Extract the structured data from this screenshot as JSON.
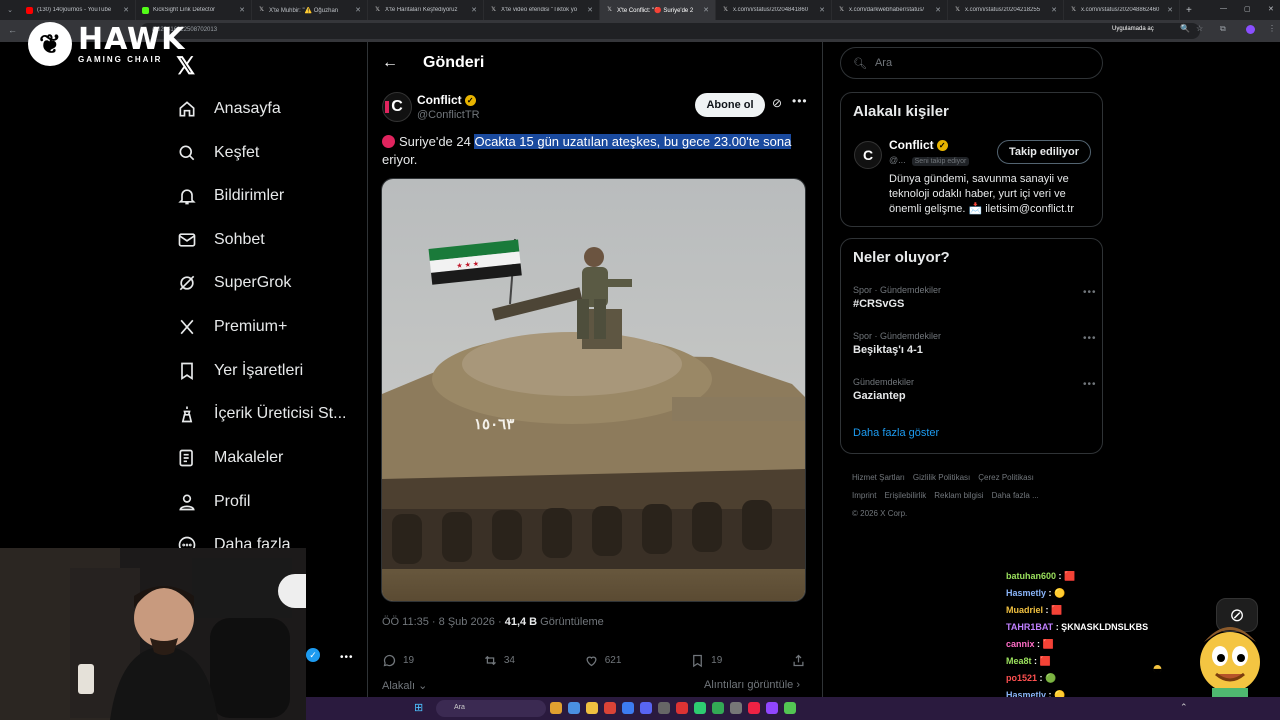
{
  "browser": {
    "tabs": [
      {
        "title": "(130) 140journos - YouTube",
        "icon": "youtube-icon",
        "active": false
      },
      {
        "title": "KickSight Link Detector",
        "icon": "kick-icon",
        "active": false
      },
      {
        "title": "X'te Muhbir: \"⚠️ Oğuzhan",
        "icon": "x-icon",
        "active": false
      },
      {
        "title": "X'te Haritaları Keşfediyoruz",
        "icon": "x-icon",
        "active": false
      },
      {
        "title": "X'te video efendisi \"Tiktok yo",
        "icon": "x-icon",
        "active": false
      },
      {
        "title": "X'te Conflict: \"🔴 Suriye'de 2",
        "icon": "x-icon",
        "active": true
      },
      {
        "title": "x.com/i/status/20204841860",
        "icon": "x-icon",
        "active": false
      },
      {
        "title": "x.com/darkwebhaber/status/",
        "icon": "x-icon",
        "active": false
      },
      {
        "title": "x.com/i/status/20204218255",
        "icon": "x-icon",
        "active": false
      },
      {
        "title": "x.com/i/status/202048862460",
        "icon": "x-icon",
        "active": false
      }
    ],
    "url": "/2020416122508702013",
    "app_notice": "Uygulamada aç"
  },
  "overlay": {
    "brand": "HAWK",
    "brand_sub": "GAMING CHAIR"
  },
  "nav": {
    "items": [
      {
        "label": "Anasayfa",
        "icon": "home-icon"
      },
      {
        "label": "Keşfet",
        "icon": "search-icon"
      },
      {
        "label": "Bildirimler",
        "icon": "bell-icon"
      },
      {
        "label": "Sohbet",
        "icon": "mail-icon"
      },
      {
        "label": "SuperGrok",
        "icon": "grok-icon"
      },
      {
        "label": "Premium+",
        "icon": "x-premium-icon"
      },
      {
        "label": "Yer İşaretleri",
        "icon": "bookmark-icon"
      },
      {
        "label": "İçerik Üreticisi St...",
        "icon": "creator-studio-icon"
      },
      {
        "label": "Makaleler",
        "icon": "article-icon"
      },
      {
        "label": "Profil",
        "icon": "person-icon"
      },
      {
        "label": "Daha fazla",
        "icon": "more-circle-icon"
      }
    ]
  },
  "post": {
    "page_title": "Gönderi",
    "author_name": "Conflict",
    "author_handle": "@ConflictTR",
    "subscribe_label": "Abone ol",
    "text_before": "Suriye'de 24 ",
    "text_highlight": "Ocakta 15 gün uzatılan ateşkes, bu gece 23.00'te sona",
    "text_after": " eriyor.",
    "image_caption_text": "١٥٠٦٣",
    "time": "ÖÖ 11:35 · 8 Şub 2026 · ",
    "views": "41,4 B",
    "views_label": " Görüntüleme",
    "replies": "19",
    "reposts": "34",
    "likes": "621",
    "bookmarks": "19",
    "relevant_label": "Alakalı",
    "quotes_label": "Alıntıları görüntüle"
  },
  "right": {
    "search_placeholder": "Ara",
    "related_title": "Alakalı kişiler",
    "related_name": "Conflict",
    "related_handle": "@...",
    "related_follows_you": "Seni takip ediyor",
    "related_button": "Takip ediliyor",
    "related_bio": "Dünya gündemi, savunma sanayii ve teknoloji odaklı haber, yurt içi veri ve önemli gelişme. 📩 iletisim@conflict.tr",
    "trends_title": "Neler oluyor?",
    "trends": [
      {
        "category": "Spor · Gündemdekiler",
        "name": "#CRSvGS"
      },
      {
        "category": "Spor · Gündemdekiler",
        "name": "Beşiktaş'ı 4-1"
      },
      {
        "category": "Gündemdekiler",
        "name": "Gaziantep"
      }
    ],
    "show_more": "Daha fazla göster",
    "footer": [
      "Hizmet Şartları",
      "Gizlilik Politikası",
      "Çerez Politikası",
      "Imprint",
      "Erişilebilirlik",
      "Reklam bilgisi",
      "Daha fazla ...",
      "© 2026 X Corp."
    ]
  },
  "chat": [
    {
      "user": "batuhan600",
      "color": "#9be15d",
      "msg": ": 🟥"
    },
    {
      "user": "Hasmetly",
      "color": "#8ab4f8",
      "msg": ": 🟡"
    },
    {
      "user": "Muadriel",
      "color": "#f0c040",
      "msg": ": 🟥"
    },
    {
      "user": "TAHR1BAT",
      "color": "#c080ff",
      "msg": ": ŞKNASKLDNSLKBS"
    },
    {
      "user": "cannix",
      "color": "#ff6ec7",
      "msg": ": 🟥"
    },
    {
      "user": "Mea8t",
      "color": "#9be15d",
      "msg": ": 🟥"
    },
    {
      "user": "po1521",
      "color": "#ff5050",
      "msg": ": 🟢"
    },
    {
      "user": "Hasmetly",
      "color": "#8ab4f8",
      "msg": ": 🟡"
    }
  ],
  "taskbar": {
    "search": "Ara"
  }
}
